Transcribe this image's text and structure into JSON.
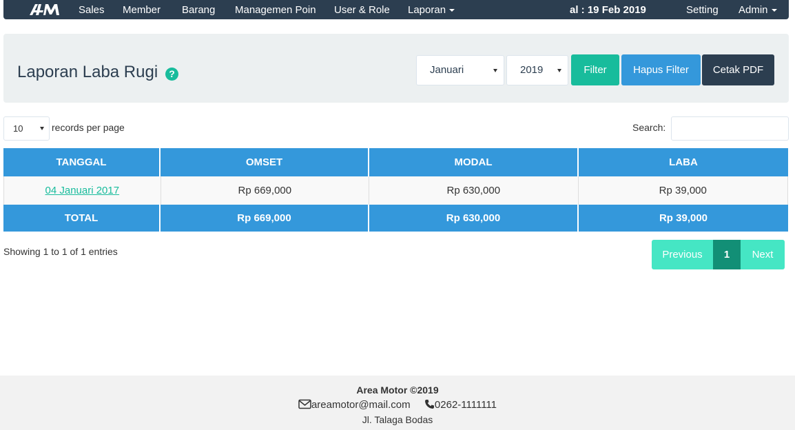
{
  "navbar": {
    "items": [
      {
        "label": "Sales"
      },
      {
        "label": "Member"
      },
      {
        "label": "Barang"
      },
      {
        "label": "Managemen Poin"
      },
      {
        "label": "User & Role"
      },
      {
        "label": "Laporan"
      }
    ],
    "date": "al : 19 Feb 2019",
    "setting": "Setting",
    "admin": "Admin"
  },
  "header": {
    "title": "Laporan Laba Rugi",
    "help_glyph": "?",
    "month_select": "Januari",
    "year_select": "2019",
    "filter_btn": "Filter",
    "clear_btn": "Hapus Filter",
    "pdf_btn": "Cetak PDF"
  },
  "table_controls": {
    "length_value": "10",
    "length_label": "records per page",
    "search_label": "Search:",
    "search_value": ""
  },
  "table": {
    "columns": [
      "TANGGAL",
      "OMSET",
      "MODAL",
      "LABA"
    ],
    "rows": [
      {
        "tanggal": "04 Januari 2017",
        "omset": "Rp 669,000",
        "modal": "Rp 630,000",
        "laba": "Rp 39,000"
      }
    ],
    "total": {
      "label": "TOTAL",
      "omset": "Rp 669,000",
      "modal": "Rp 630,000",
      "laba": "Rp 39,000"
    }
  },
  "pagination": {
    "info": "Showing 1 to 1 of 1 entries",
    "prev": "Previous",
    "current": "1",
    "next": "Next"
  },
  "footer": {
    "company": "Area Motor ©2019",
    "email": "areamotor@mail.com",
    "phone": "0262-1111111",
    "address": "Jl. Talaga Bodas"
  },
  "colors": {
    "navbar": "#2c3e50",
    "primary": "#3498db",
    "success": "#18bc9c",
    "dark": "#2c3e50"
  }
}
